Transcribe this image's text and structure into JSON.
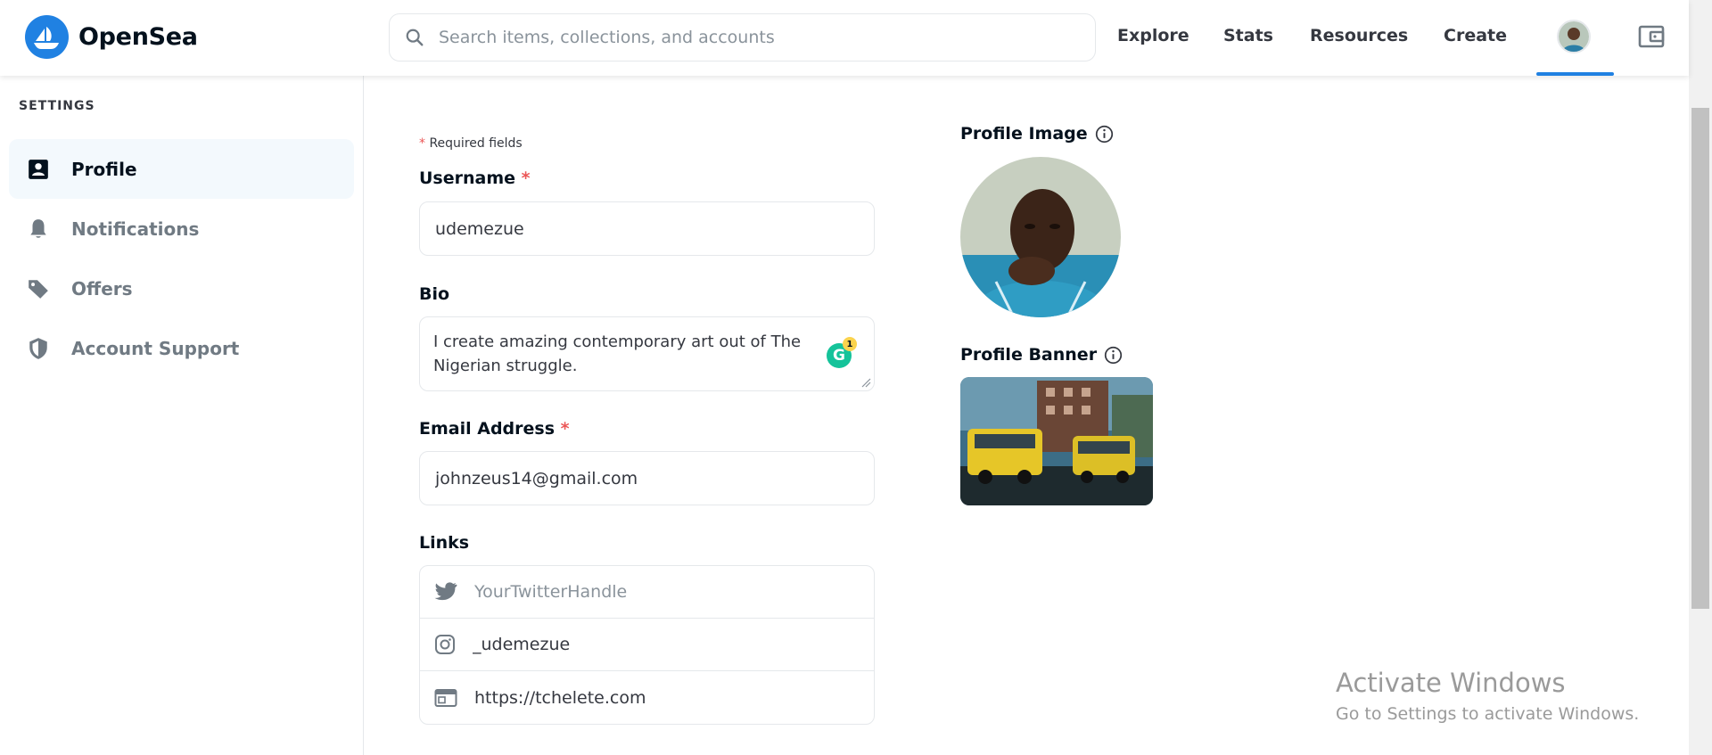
{
  "header": {
    "brand": "OpenSea",
    "search_placeholder": "Search items, collections, and accounts",
    "nav": [
      "Explore",
      "Stats",
      "Resources",
      "Create"
    ],
    "accent_color": "#2081e2"
  },
  "sidebar": {
    "heading": "SETTINGS",
    "items": [
      {
        "label": "Profile",
        "icon": "profile-card-icon",
        "active": true
      },
      {
        "label": "Notifications",
        "icon": "bell-icon",
        "active": false
      },
      {
        "label": "Offers",
        "icon": "tag-icon",
        "active": false
      },
      {
        "label": "Account Support",
        "icon": "shield-icon",
        "active": false
      }
    ]
  },
  "form": {
    "required_note": "Required fields",
    "required_marker": "*",
    "username": {
      "label": "Username",
      "value": "udemezue"
    },
    "bio": {
      "label": "Bio",
      "value": "I create amazing contemporary art out of The Nigerian struggle.",
      "grammarly_badge": "1"
    },
    "email": {
      "label": "Email Address",
      "value": "johnzeus14@gmail.com"
    },
    "links": {
      "label": "Links",
      "twitter_placeholder": "YourTwitterHandle",
      "twitter_value": "",
      "instagram_value": "_udemezue",
      "website_value": "https://tchelete.com"
    }
  },
  "media": {
    "profile_image_label": "Profile Image",
    "profile_banner_label": "Profile Banner"
  },
  "watermark": {
    "title": "Activate Windows",
    "subtitle": "Go to Settings to activate Windows."
  }
}
